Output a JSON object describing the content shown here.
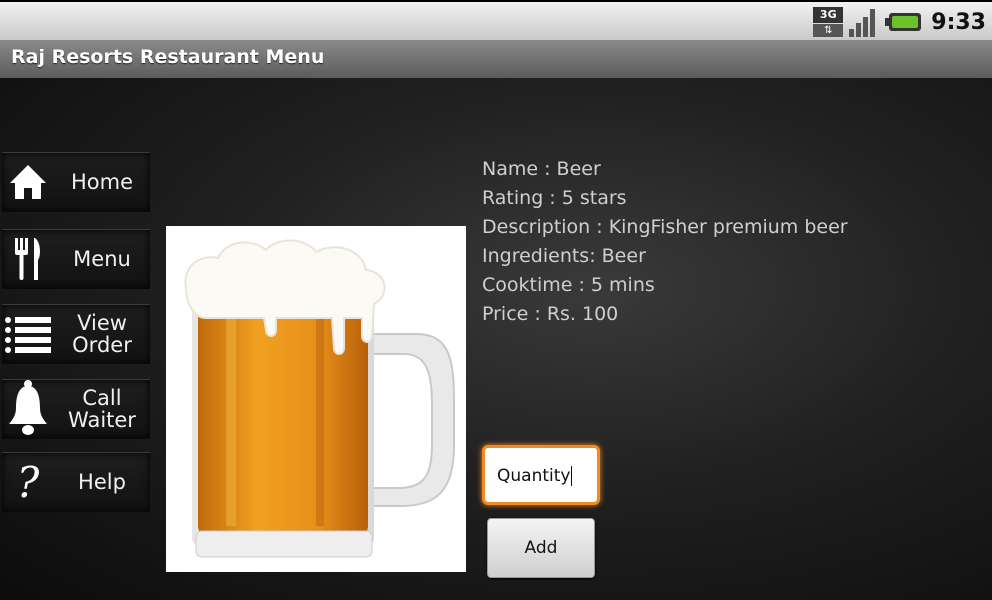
{
  "status_bar": {
    "network_label": "3G",
    "time": "9:33"
  },
  "app": {
    "title": "Raj Resorts Restaurant Menu"
  },
  "nav": [
    {
      "label": "Home",
      "icon": "home-icon"
    },
    {
      "label": "Menu",
      "icon": "fork-knife-icon"
    },
    {
      "label": "View Order",
      "icon": "list-icon"
    },
    {
      "label": "Call Waiter",
      "icon": "bell-icon"
    },
    {
      "label": "Help",
      "icon": "question-icon"
    }
  ],
  "item": {
    "name": "Name : Beer",
    "rating": "Rating : 5 stars",
    "description": "Description : KingFisher premium beer",
    "ingredients": "Ingredients: Beer",
    "cooktime": "Cooktime : 5 mins",
    "price": "Price : Rs. 100"
  },
  "order": {
    "quantity_value": "Quantity",
    "add_label": "Add"
  },
  "colors": {
    "accent": "#f08a24",
    "battery": "#6cc22b"
  }
}
